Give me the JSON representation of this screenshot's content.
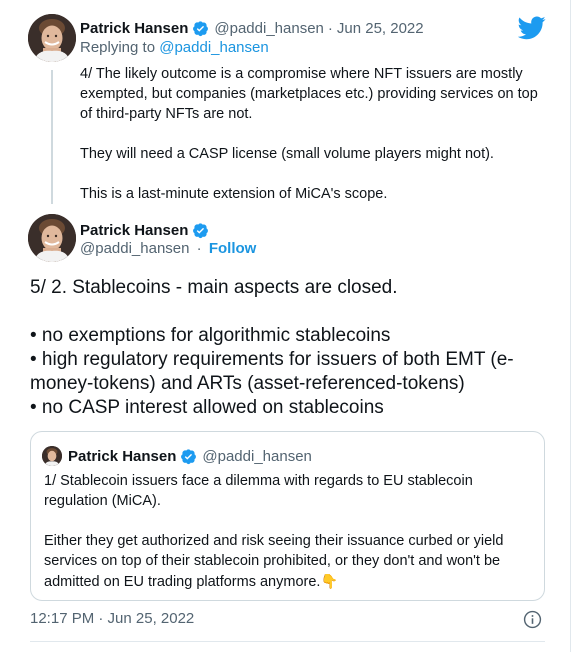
{
  "colors": {
    "accent": "#1b95e0",
    "muted": "#536471",
    "text": "#0f1419",
    "border": "#cfd9de"
  },
  "previous_tweet": {
    "author_name": "Patrick Hansen",
    "handle": "@paddi_hansen",
    "separator": "·",
    "date": "Jun 25, 2022",
    "replying_label": "Replying to",
    "replying_to": "@paddi_hansen",
    "paragraphs": [
      "4/ The likely outcome is a compromise where NFT issuers are mostly exempted, but companies (marketplaces etc.) providing services on top of third-party NFTs are not.",
      "They will need a CASP license (small volume players might not).",
      "This is a last-minute extension of MiCA's scope."
    ]
  },
  "main_tweet": {
    "author_name": "Patrick Hansen",
    "handle": "@paddi_hansen",
    "separator": "·",
    "follow_label": "Follow",
    "lines": [
      "5/ 2. Stablecoins - main aspects are closed.",
      "• no exemptions for algorithmic stablecoins",
      "• high regulatory requirements for issuers of both EMT (e-money-tokens) and ARTs (asset-referenced-tokens)",
      "• no CASP interest allowed on stablecoins"
    ],
    "timestamp": "12:17 PM · Jun 25, 2022"
  },
  "quoted_tweet": {
    "author_name": "Patrick Hansen",
    "handle": "@paddi_hansen",
    "paragraphs": [
      "1/ Stablecoin issuers face a dilemma with regards to EU stablecoin regulation (MiCA).",
      "Either they get authorized and risk seeing their issuance curbed or yield services on top of their stablecoin prohibited, or they don't and won't be admitted on EU trading platforms anymore."
    ],
    "emoji": "👇"
  },
  "icons": {
    "logo": "twitter-bird-icon",
    "verified": "verified-badge-icon",
    "info": "info-icon"
  }
}
